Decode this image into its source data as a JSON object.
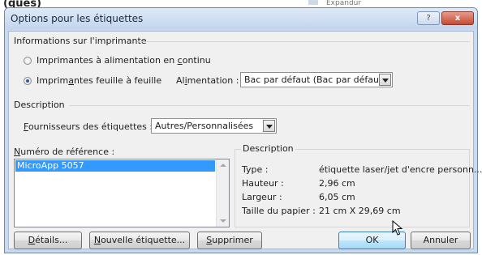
{
  "background": {
    "top_fragment": "(ques)",
    "tab_fragment": "Expandur"
  },
  "dialog": {
    "title": "Options pour les étiquettes",
    "help_label": "?",
    "close_label": "x"
  },
  "printer": {
    "group_label": "Informations sur l'imprimante",
    "continuous": {
      "prefix": "Imprimantes à alimentation en ",
      "accel": "c",
      "suffix": "ontinu",
      "selected": false
    },
    "page": {
      "prefix": "Imprim",
      "accel": "a",
      "suffix": "ntes feuille à feuille",
      "selected": true
    },
    "tray": {
      "label_prefix": "Al",
      "label_accel": "i",
      "label_suffix": "mentation :",
      "value": "Bac par défaut (Bac par défaut)"
    }
  },
  "description_section": {
    "group_label": "Description",
    "vendor": {
      "label_accel": "F",
      "label_rest": "ournisseurs des étiquettes :",
      "value": "Autres/Personnalisées"
    }
  },
  "product_list": {
    "label_accel": "N",
    "label_rest": "uméro de référence :",
    "items": [
      "MicroApp 5057"
    ],
    "selected_index": 0
  },
  "label_info": {
    "group_label": "Description",
    "rows": [
      {
        "key": "Type :",
        "value": "étiquette laser/jet d'encre personn..."
      },
      {
        "key": "Hauteur :",
        "value": "2,96 cm"
      },
      {
        "key": "Largeur :",
        "value": "6,05 cm"
      },
      {
        "key": "Taille du papier :",
        "value": "21 cm X 29,69 cm"
      }
    ]
  },
  "buttons": {
    "details": {
      "accel": "D",
      "rest": "étails..."
    },
    "new_label": {
      "accel": "N",
      "rest": "ouvelle étiquette..."
    },
    "delete": {
      "accel": "S",
      "rest": "upprimer"
    },
    "ok": "OK",
    "cancel": "Annuler"
  },
  "icons": [
    "radio-button",
    "dropdown-arrow-icon",
    "scroll-up-icon",
    "scroll-down-icon",
    "mouse-cursor-icon"
  ]
}
